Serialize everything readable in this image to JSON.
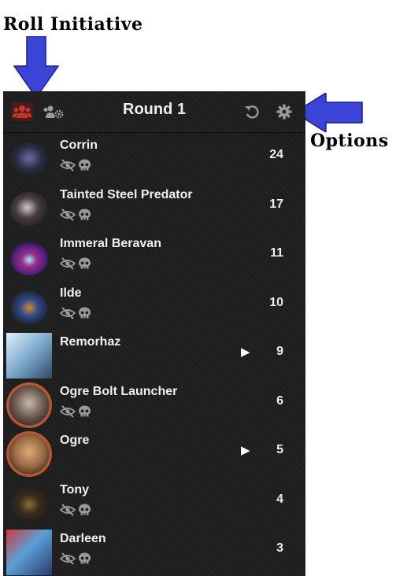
{
  "callouts": {
    "roll": "Roll Initiative",
    "options": "Options"
  },
  "header": {
    "round_label": "Round 1",
    "icons": {
      "roll_all": "users-icon",
      "roll_npcs": "users-gear-icon",
      "reset": "undo-icon",
      "options": "gear-icon"
    }
  },
  "combatants": [
    {
      "name": "Corrin",
      "initiative": "24",
      "hidden_icons": true,
      "turn_marker": false
    },
    {
      "name": "Tainted Steel Predator",
      "initiative": "17",
      "hidden_icons": true,
      "turn_marker": false
    },
    {
      "name": "Immeral Beravan",
      "initiative": "11",
      "hidden_icons": true,
      "turn_marker": false
    },
    {
      "name": "Ilde",
      "initiative": "10",
      "hidden_icons": true,
      "turn_marker": false
    },
    {
      "name": "Remorhaz",
      "initiative": "9",
      "hidden_icons": false,
      "turn_marker": true
    },
    {
      "name": "Ogre Bolt Launcher",
      "initiative": "6",
      "hidden_icons": true,
      "turn_marker": false
    },
    {
      "name": "Ogre",
      "initiative": "5",
      "hidden_icons": false,
      "turn_marker": true
    },
    {
      "name": "Tony",
      "initiative": "4",
      "hidden_icons": true,
      "turn_marker": false
    },
    {
      "name": "Darleen",
      "initiative": "3",
      "hidden_icons": true,
      "turn_marker": false
    }
  ],
  "colors": {
    "panel_bg": "#1e1e1e",
    "callout_arrow": "#3b44d6",
    "roll_button_active": "#c0392b"
  },
  "turn_marker_glyph": "▶"
}
